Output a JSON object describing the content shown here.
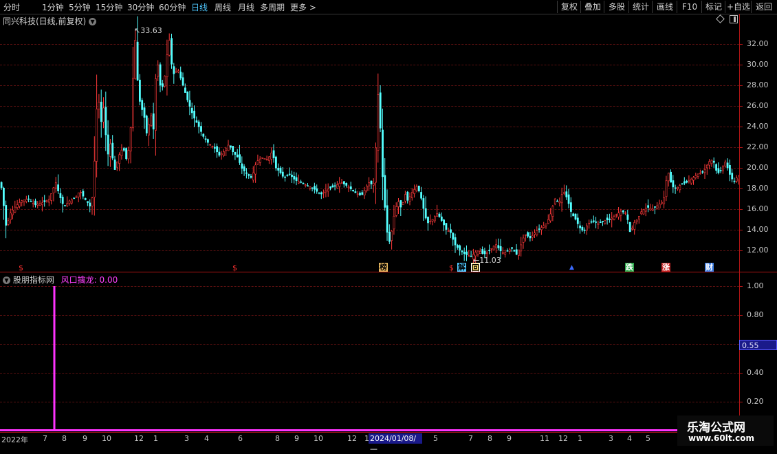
{
  "toolbar": {
    "periods": [
      "分时",
      "1分钟",
      "5分钟",
      "15分钟",
      "30分钟",
      "60分钟",
      "日线",
      "周线",
      "月线",
      "多周期",
      "更多 >"
    ],
    "buttons": [
      "复权",
      "叠加",
      "多股",
      "统计",
      "画线",
      "F10",
      "标记",
      "+自选",
      "返回"
    ]
  },
  "main_chart": {
    "title": "同兴科技(日线,前复权)",
    "high_label": "33.63",
    "low_label": "11.03",
    "y_ticks": [
      "32.00",
      "30.00",
      "28.00",
      "26.00",
      "24.00",
      "22.00",
      "20.00",
      "18.00",
      "16.00",
      "14.00",
      "12.00"
    ],
    "markers": [
      "$",
      "$",
      "榜",
      "$",
      "解",
      "回",
      "▲",
      "跌",
      "涨",
      "财"
    ]
  },
  "sub_chart": {
    "title": "股朋指标网",
    "indicator": "风口擒龙: 0.00",
    "y_ticks": [
      "1.00",
      "0.80",
      "0.60",
      "0.40",
      "0.20"
    ],
    "value_box": "0.55"
  },
  "date_axis": {
    "labels": [
      "2022年",
      "7",
      "8",
      "9",
      "10",
      "12",
      "1",
      "3",
      "4",
      "6",
      "8",
      "9",
      "10",
      "12",
      "1",
      "5",
      "7",
      "8",
      "9",
      "11",
      "12",
      "1",
      "3",
      "4",
      "5"
    ],
    "cursor": "2024/01/08/—"
  },
  "watermark": {
    "title": "乐淘公式网",
    "url": "www.60lt.com"
  },
  "colors": {
    "up": "#ff3a3a",
    "down": "#54ffff",
    "indicator": "#ff33ff",
    "axis": "#b01515"
  },
  "chart_data": {
    "type": "candlestick",
    "title": "同兴科技(日线,前复权)",
    "ylim": [
      11,
      33.9
    ],
    "y_ticks": [
      12,
      14,
      16,
      18,
      20,
      22,
      24,
      26,
      28,
      30,
      32
    ],
    "close_path": [
      [
        0,
        18.6
      ],
      [
        4,
        16.5
      ],
      [
        8,
        14.2
      ],
      [
        14,
        15.6
      ],
      [
        22,
        16.3
      ],
      [
        30,
        16.8
      ],
      [
        40,
        17.0
      ],
      [
        50,
        16.4
      ],
      [
        60,
        16.6
      ],
      [
        70,
        16.9
      ],
      [
        80,
        18.6
      ],
      [
        85,
        17.4
      ],
      [
        92,
        16.2
      ],
      [
        100,
        16.8
      ],
      [
        110,
        17.2
      ],
      [
        115,
        17.8
      ],
      [
        122,
        17.0
      ],
      [
        128,
        16.5
      ],
      [
        132,
        16.0
      ],
      [
        138,
        22.5
      ],
      [
        141,
        28.5
      ],
      [
        145,
        24.0
      ],
      [
        150,
        26.0
      ],
      [
        155,
        21.0
      ],
      [
        160,
        22.5
      ],
      [
        165,
        19.6
      ],
      [
        172,
        21.2
      ],
      [
        178,
        22.0
      ],
      [
        184,
        20.5
      ],
      [
        190,
        24.5
      ],
      [
        195,
        33.2
      ],
      [
        199,
        28.5
      ],
      [
        203,
        26.0
      ],
      [
        208,
        25.3
      ],
      [
        213,
        23.0
      ],
      [
        218,
        25.4
      ],
      [
        222,
        23.6
      ],
      [
        227,
        31.0
      ],
      [
        232,
        28.0
      ],
      [
        237,
        27.8
      ],
      [
        241,
        30.5
      ],
      [
        245,
        32.5
      ],
      [
        250,
        29.0
      ],
      [
        258,
        29.5
      ],
      [
        265,
        28.0
      ],
      [
        272,
        26.5
      ],
      [
        280,
        25.0
      ],
      [
        288,
        24.0
      ],
      [
        295,
        23.0
      ],
      [
        302,
        22.4
      ],
      [
        310,
        22.0
      ],
      [
        318,
        21.2
      ],
      [
        325,
        21.6
      ],
      [
        332,
        22.3
      ],
      [
        338,
        21.5
      ],
      [
        345,
        21.0
      ],
      [
        350,
        20.0
      ],
      [
        358,
        19.4
      ],
      [
        365,
        19.0
      ],
      [
        372,
        20.6
      ],
      [
        380,
        21.0
      ],
      [
        388,
        20.8
      ],
      [
        395,
        21.6
      ],
      [
        400,
        20.0
      ],
      [
        406,
        19.6
      ],
      [
        412,
        19.0
      ],
      [
        420,
        19.4
      ],
      [
        428,
        18.8
      ],
      [
        436,
        18.6
      ],
      [
        445,
        18.3
      ],
      [
        455,
        18.0
      ],
      [
        465,
        17.4
      ],
      [
        475,
        17.9
      ],
      [
        485,
        18.2
      ],
      [
        495,
        18.6
      ],
      [
        505,
        18.2
      ],
      [
        515,
        17.6
      ],
      [
        525,
        17.3
      ],
      [
        535,
        18.6
      ],
      [
        542,
        18.3
      ],
      [
        547,
        23.5
      ],
      [
        550,
        29.5
      ],
      [
        552,
        24.0
      ],
      [
        555,
        19.5
      ],
      [
        560,
        15.0
      ],
      [
        564,
        12.5
      ],
      [
        568,
        13.6
      ],
      [
        573,
        15.8
      ],
      [
        578,
        16.8
      ],
      [
        583,
        16.0
      ],
      [
        588,
        17.5
      ],
      [
        592,
        16.8
      ],
      [
        598,
        17.6
      ],
      [
        605,
        18.2
      ],
      [
        610,
        17.5
      ],
      [
        615,
        16.0
      ],
      [
        620,
        14.6
      ],
      [
        628,
        15.0
      ],
      [
        635,
        15.6
      ],
      [
        642,
        14.8
      ],
      [
        648,
        14.0
      ],
      [
        654,
        13.8
      ],
      [
        660,
        12.6
      ],
      [
        668,
        12.0
      ],
      [
        676,
        11.6
      ],
      [
        684,
        11.4
      ],
      [
        690,
        11.8
      ],
      [
        696,
        12.0
      ],
      [
        702,
        11.6
      ],
      [
        708,
        11.8
      ],
      [
        714,
        12.2
      ],
      [
        720,
        12.6
      ],
      [
        726,
        12.0
      ],
      [
        732,
        11.7
      ],
      [
        738,
        12.0
      ],
      [
        744,
        12.2
      ],
      [
        750,
        11.6
      ],
      [
        756,
        12.4
      ],
      [
        762,
        13.6
      ],
      [
        770,
        13.2
      ],
      [
        778,
        13.8
      ],
      [
        786,
        14.2
      ],
      [
        794,
        14.6
      ],
      [
        800,
        15.6
      ],
      [
        806,
        17.0
      ],
      [
        812,
        16.6
      ],
      [
        818,
        17.8
      ],
      [
        824,
        17.0
      ],
      [
        830,
        15.6
      ],
      [
        836,
        15.0
      ],
      [
        842,
        14.2
      ],
      [
        848,
        13.8
      ],
      [
        854,
        14.6
      ],
      [
        862,
        14.8
      ],
      [
        870,
        14.6
      ],
      [
        878,
        14.9
      ],
      [
        886,
        15.0
      ],
      [
        894,
        15.4
      ],
      [
        902,
        15.8
      ],
      [
        910,
        15.6
      ],
      [
        916,
        13.5
      ],
      [
        920,
        14.6
      ],
      [
        926,
        15.0
      ],
      [
        932,
        15.8
      ],
      [
        940,
        16.2
      ],
      [
        948,
        16.0
      ],
      [
        956,
        16.4
      ],
      [
        964,
        16.8
      ],
      [
        970,
        19.8
      ],
      [
        976,
        18.2
      ],
      [
        982,
        18.0
      ],
      [
        990,
        18.4
      ],
      [
        998,
        18.6
      ],
      [
        1006,
        19.0
      ],
      [
        1014,
        19.4
      ],
      [
        1022,
        19.6
      ],
      [
        1030,
        20.6
      ],
      [
        1036,
        20.8
      ],
      [
        1042,
        19.4
      ],
      [
        1048,
        19.8
      ],
      [
        1054,
        20.6
      ],
      [
        1060,
        19.4
      ],
      [
        1066,
        18.6
      ],
      [
        1072,
        19.2
      ]
    ],
    "sub_indicator": {
      "name": "风口擒龙",
      "ylim": [
        0,
        1.0
      ],
      "signal_bars": [
        [
          79,
          1.0
        ]
      ]
    }
  }
}
